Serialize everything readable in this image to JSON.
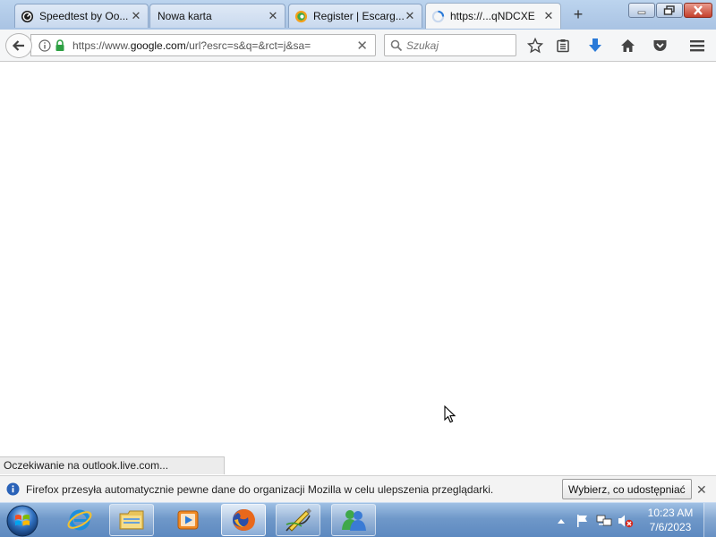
{
  "browser": {
    "tabs": [
      {
        "title": "Speedtest by Oo...",
        "icon": "speedtest-icon",
        "active": false
      },
      {
        "title": "Nowa karta",
        "icon": "",
        "active": false
      },
      {
        "title": "Register | Escarg...",
        "icon": "escargot-icon",
        "active": false
      },
      {
        "title": "https://...qNDCXE",
        "icon": "loading-spinner-icon",
        "active": true
      }
    ],
    "new_tab_label": "+",
    "url": {
      "prefix": "https://www.",
      "host": "google.com",
      "path": "/url?esrc=s&q=&rct=j&sa="
    },
    "search_placeholder": "Szukaj",
    "status_text": "Oczekiwanie na outlook.live.com..."
  },
  "notification": {
    "message": "Firefox przesyła automatycznie pewne dane do organizacji Mozilla w celu ulepszenia przeglądarki.",
    "button_label": "Wybierz, co udostępniać"
  },
  "taskbar": {
    "apps": [
      "internet-explorer-icon",
      "file-explorer-icon",
      "media-player-icon",
      "firefox-icon",
      "paint-tool-icon",
      "messenger-icon"
    ],
    "clock": {
      "time": "10:23 AM",
      "date": "7/6/2023"
    }
  },
  "colors": {
    "taskbar": "#6f98c9",
    "tabstrip": "#bcd4ee",
    "download_arrow": "#2a7ad8"
  }
}
